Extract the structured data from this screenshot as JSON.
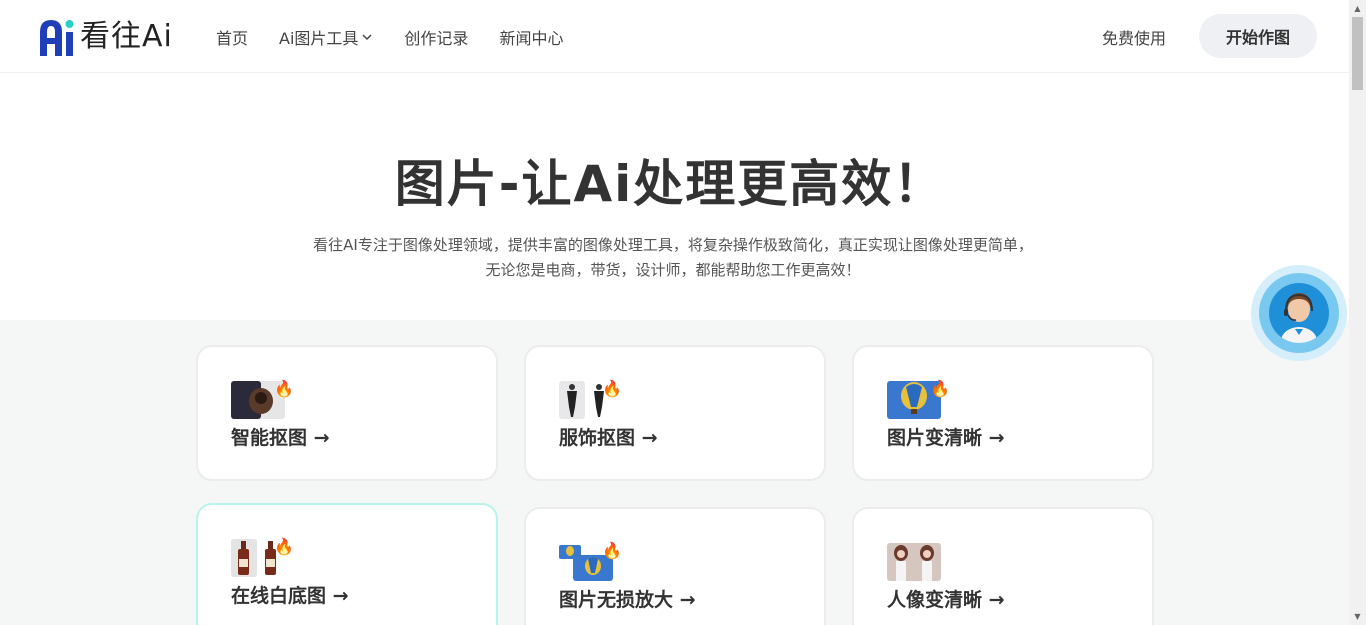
{
  "header": {
    "logo_text": "看往Ai",
    "logo_mark": "Ai",
    "nav": [
      {
        "label": "首页"
      },
      {
        "label": "Ai图片工具"
      },
      {
        "label": "创作记录"
      },
      {
        "label": "新闻中心"
      }
    ],
    "free_label": "免费使用",
    "start_label": "开始作图"
  },
  "hero": {
    "title": "图片-让Ai处理更高效！",
    "subtitle_line1": "看往AI专注于图像处理领域，提供丰富的图像处理工具，将复杂操作极致简化，真正实现让图像处理更简单，",
    "subtitle_line2": "无论您是电商，带货，设计师，都能帮助您工作更高效！"
  },
  "tools": [
    {
      "label": "智能抠图 →",
      "icon": "cutout-thumb-icon",
      "badge": "fire-icon"
    },
    {
      "label": "服饰抠图 →",
      "icon": "clothing-thumb-icon",
      "badge": "fire-icon"
    },
    {
      "label": "图片变清晰 →",
      "icon": "balloon-thumb-icon",
      "badge": "fire-icon"
    },
    {
      "label": "在线白底图 →",
      "icon": "bottle-thumb-icon",
      "badge": "fire-icon"
    },
    {
      "label": "图片无损放大 →",
      "icon": "enlarge-thumb-icon",
      "badge": "fire-icon"
    },
    {
      "label": "人像变清晰 →",
      "icon": "portrait-thumb-icon",
      "badge": ""
    }
  ],
  "fire_glyph": "🔥",
  "colors": {
    "logo_blue": "#1f3fb8",
    "active_border": "#b8f4ea",
    "tools_bg": "#f5f7f6",
    "support_blue": "#1f8fd8"
  }
}
